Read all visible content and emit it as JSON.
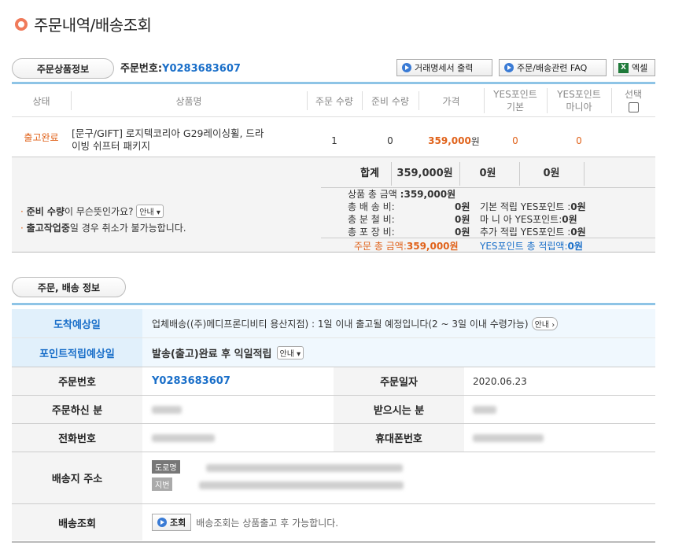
{
  "page_title": "주문내역/배송조회",
  "product_section": {
    "tab_label": "주문상품정보",
    "order_label": "주문번호:",
    "order_number": "Y0283683607",
    "buttons": {
      "receipt": "거래명세서 출력",
      "faq": "주문/배송관련 FAQ",
      "excel": "엑셀"
    },
    "columns": {
      "status": "상태",
      "product": "상품명",
      "qty": "주문 수량",
      "ready_qty": "준비 수량",
      "price": "가격",
      "yes_basic_1": "YES포인트",
      "yes_basic_2": "기본",
      "yes_mania_1": "YES포인트",
      "yes_mania_2": "마니아",
      "select": "선택"
    },
    "row": {
      "status": "출고완료",
      "product_line1": "[문구/GIFT] 로지텍코리아 G29레이싱휠, 드라",
      "product_line2": "이빙 쉬프터 패키지",
      "qty": "1",
      "ready_qty": "0",
      "price_num": "359,000",
      "price_unit": "원",
      "yes_basic": "0",
      "yes_mania": "0"
    },
    "total_row": {
      "label": "합계",
      "price": "359,000원",
      "basic": "0원",
      "mania": "0원"
    },
    "notes": {
      "note1_bold": "준비 수량",
      "note1_rest": "이 무슨뜻인가요?",
      "note1_btn": "안내",
      "note2_bold": "출고작업중",
      "note2_rest": "일 경우 취소가 불가능합니다."
    },
    "summary": {
      "product_total_label": "상품 총 금액",
      "product_total": ":359,000원",
      "shipping_label": "총 배 송 비:",
      "shipping": "0원",
      "split_label": "총 분 철 비:",
      "split": "0원",
      "wrap_label": "총 포 장 비:",
      "wrap": "0원",
      "basic_label": "기본 적립 YES포인트 :",
      "basic": "0원",
      "mania_label": "마 니 아 YES포인트:",
      "mania": "0원",
      "extra_label": "추가 적립 YES포인트 :",
      "extra": "0원",
      "grand_label": "주문 총 금액:",
      "grand": "359,000원",
      "points_label": "YES포인트 총 적립액:",
      "points": "0원"
    }
  },
  "delivery_section": {
    "tab_label": "주문, 배송 정보",
    "arrival_label": "도착예상일",
    "arrival_value": "업체배송((주)메디프론디비티 용산지점) : 1일 이내 출고될 예정입니다(2 ~ 3일 이내 수령가능)",
    "arrival_btn": "안내",
    "points_label": "포인트적립예상일",
    "points_value": "발송(출고)완료 후 익일적립",
    "points_btn": "안내",
    "order_no_label": "주문번호",
    "order_no": "Y0283683607",
    "order_date_label": "주문일자",
    "order_date": "2020.06.23",
    "orderer_label": "주문하신 분",
    "receiver_label": "받으시는 분",
    "phone_label": "전화번호",
    "mobile_label": "휴대폰번호",
    "address_label": "배송지 주소",
    "addr_road": "도로명",
    "addr_lot": "지번",
    "tracking_label": "배송조회",
    "tracking_btn": "조회",
    "tracking_note": "배송조회는 상품출고 후 가능합니다."
  },
  "colors": {
    "accent_blue": "#1a6fc9",
    "accent_orange": "#e0621a",
    "line_blue": "#8ec4e6",
    "label_blue_bg": "#e1f0fb"
  }
}
